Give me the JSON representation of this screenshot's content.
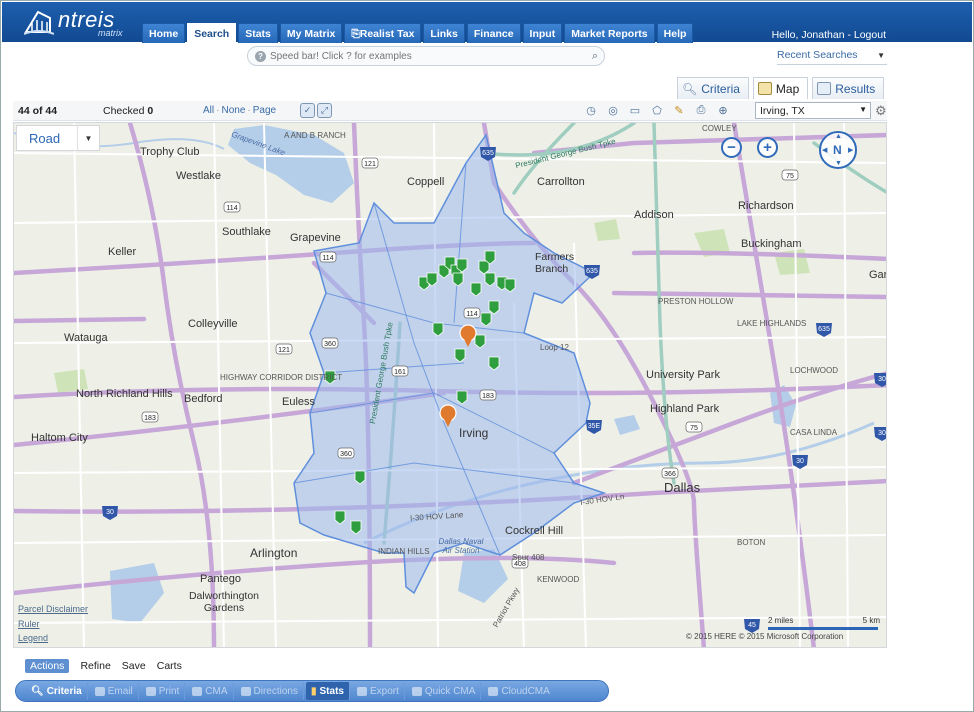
{
  "brand": {
    "name": "ntreis",
    "sub": "matrix"
  },
  "nav": {
    "tabs": [
      "Home",
      "Search",
      "Stats",
      "My Matrix",
      "Realist Tax",
      "Links",
      "Finance",
      "Input",
      "Market Reports",
      "Help"
    ],
    "active": "Search"
  },
  "user": {
    "greeting": "Hello, Jonathan",
    "separator": " - ",
    "logout": "Logout"
  },
  "speedbar": {
    "placeholder": "Speed bar! Click ? for examples",
    "help_glyph": "?"
  },
  "recent_searches": "Recent Searches",
  "view_tabs": {
    "criteria": "Criteria",
    "map": "Map",
    "results": "Results",
    "active": "Map"
  },
  "toolbar": {
    "count": "44 of 44",
    "checked_label": "Checked",
    "checked_value": "0",
    "select_all": "All",
    "select_none": "None",
    "select_page": "Page",
    "separator": "·",
    "location": "Irving, TX"
  },
  "map": {
    "road_mode": "Road",
    "compass_label": "N",
    "links": [
      "Parcel Disclaimer",
      "Ruler",
      "Legend"
    ],
    "scale": {
      "left": "2 miles",
      "right": "5 km"
    },
    "copyright": "© 2015 HERE   © 2015 Microsoft Corporation",
    "places": [
      "Trophy Club",
      "Westlake",
      "Coppell",
      "Carrollton",
      "Southlake",
      "Grapevine",
      "Addison",
      "Richardson",
      "Keller",
      "Farmers Branch",
      "Buckingham",
      "Watauga",
      "Colleyville",
      "University Park",
      "Highland Park",
      "North Richland Hills",
      "Bedford",
      "Euless",
      "Irving",
      "Haltom City",
      "Dallas",
      "Cockrell Hill",
      "Arlington",
      "Pantego",
      "Dalworthington Gardens",
      "Gar"
    ],
    "roads": [
      "President George Bush Tpke",
      "I-30 HOV Lane",
      "I-30 HOV Ln",
      "Grapevine Lake",
      "President George Bush Tpke",
      "Loop 12",
      "Spur 408",
      "Patriot Pkwy",
      "HIGHWAY CORRIDOR DISTRICT",
      "LAKE HIGHLANDS",
      "LOCHWOOD",
      "CASA LINDA",
      "BOTON",
      "KENWOOD",
      "INDIAN HILLS",
      "Dallas Naval Air Station",
      "PRESTON HOLLOW",
      "A AND B RANCH",
      "COWLEY"
    ],
    "listing_count": 44
  },
  "actions_row": {
    "items": [
      "Actions",
      "Refine",
      "Save",
      "Carts"
    ],
    "active": "Actions"
  },
  "action_bar": {
    "buttons": [
      "Criteria",
      "Email",
      "Print",
      "CMA",
      "Directions",
      "Stats",
      "Export",
      "Quick CMA",
      "CloudCMA"
    ],
    "enabled": [
      "Criteria",
      "Stats"
    ]
  },
  "colors": {
    "header": "#1d5fae",
    "accent": "#2b66b8",
    "search_polygon": "#9fb9ec",
    "listing_pin": "#2e9e3f",
    "focus_pin": "#e07a2e"
  }
}
